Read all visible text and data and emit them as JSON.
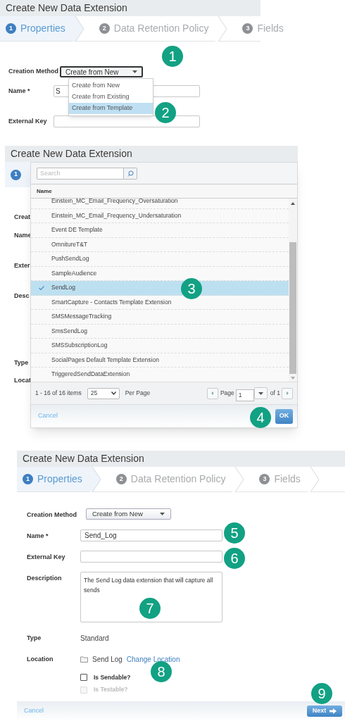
{
  "screen_1": {
    "title": "Create New Data Extension",
    "steps": [
      {
        "number": "1",
        "label": "Properties",
        "selected": true
      },
      {
        "number": "2",
        "label": "Data Retention Policy",
        "selected": false
      },
      {
        "number": "3",
        "label": "Fields",
        "selected": false
      }
    ],
    "creation_method": {
      "label": "Creation Method",
      "value": "Create from New"
    },
    "menu": [
      {
        "label": "Create from New",
        "selected": false
      },
      {
        "label": "Create from Existing",
        "selected": false
      },
      {
        "label": "Create from Template",
        "selected": true
      }
    ],
    "name": {
      "label": "Name *",
      "value": "S"
    },
    "external_key": {
      "label": "External Key"
    }
  },
  "screen_2": {
    "title": "Create New Data Extension",
    "step_number": "1",
    "form_labels": [
      "Creat",
      "Name",
      "Exter",
      "Desc",
      "Type",
      "Locat"
    ],
    "dialog": {
      "search_placeholder": "Search",
      "column": "Name",
      "rows": [
        {
          "label": "Einstein_MC_Email_Frequency_Oversaturation",
          "selected": false
        },
        {
          "label": "Einstein_MC_Email_Frequency_Undersaturation",
          "selected": false
        },
        {
          "label": "Event DE Template",
          "selected": false
        },
        {
          "label": "OmnitureT&T",
          "selected": false
        },
        {
          "label": "PushSendLog",
          "selected": false
        },
        {
          "label": "SampleAudience",
          "selected": false
        },
        {
          "label": "SendLog",
          "selected": true
        },
        {
          "label": "SmartCapture - Contacts Template Extension",
          "selected": false
        },
        {
          "label": "SMSMessageTracking",
          "selected": false
        },
        {
          "label": "SmsSendLog",
          "selected": false
        },
        {
          "label": "SMSSubscriptionLog",
          "selected": false
        },
        {
          "label": "SocialPages Default Template Extension",
          "selected": false
        },
        {
          "label": "TriggeredSendDataExtension",
          "selected": false
        }
      ],
      "pagination": {
        "range": "1 - 16 of 16 items",
        "per_page": "25",
        "per_page_label": "Per Page",
        "page_label": "Page",
        "page": "1",
        "page_count": "of 1"
      },
      "cancel": "Cancel",
      "ok": "OK"
    }
  },
  "screen_3": {
    "title": "Create New Data Extension",
    "steps": [
      {
        "number": "1",
        "label": "Properties",
        "selected": true
      },
      {
        "number": "2",
        "label": "Data Retention Policy",
        "selected": false
      },
      {
        "number": "3",
        "label": "Fields",
        "selected": false
      }
    ],
    "fields": [
      {
        "kind": "select",
        "label": "Creation Method",
        "value": "Create from New"
      },
      {
        "kind": "input",
        "label": "Name *",
        "value": "Send_Log"
      },
      {
        "kind": "input",
        "label": "External Key"
      },
      {
        "kind": "textarea",
        "label": "Description",
        "value": "The Send Log data extension that will capture all sends"
      },
      {
        "kind": "text",
        "label": "Type",
        "value": "Standard"
      },
      {
        "kind": "location",
        "label": "Location",
        "value": "Send Log",
        "link": "Change Location"
      }
    ],
    "checkboxes": [
      {
        "label": "Is Sendable?",
        "checked": false,
        "disabled": false
      },
      {
        "label": "Is Testable?",
        "checked": false,
        "disabled": true
      }
    ],
    "cancel": "Cancel",
    "next": "Next"
  },
  "callouts": [
    "1",
    "2",
    "3",
    "4",
    "5",
    "6",
    "7",
    "8",
    "9"
  ]
}
